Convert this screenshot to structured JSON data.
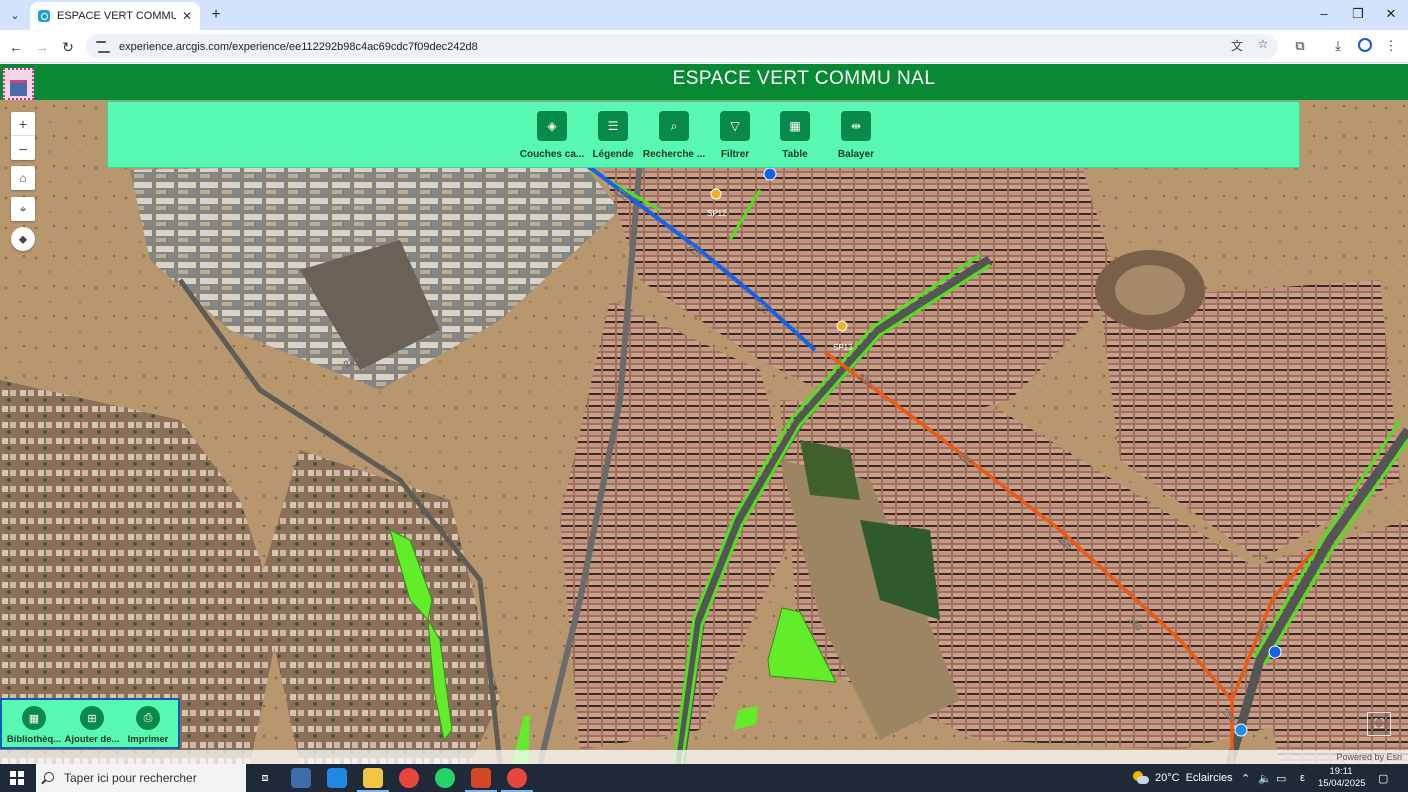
{
  "browser": {
    "tab_title": "ESPACE VERT COMMUNAL",
    "url": "experience.arcgis.com/experience/ee112292b98c4ac69cdc7f09dec242d8",
    "tab_close": "✕",
    "new_tab": "+",
    "minimize": "–",
    "restore": "❐",
    "close": "✕"
  },
  "app": {
    "title": "ESPACE VERT COMMU NAL",
    "header_color": "#088a34",
    "widget_bar_color": "#58f7b2",
    "widgets": [
      {
        "label": "Couches ca...",
        "icon": "layers-icon"
      },
      {
        "label": "Légende",
        "icon": "legend-icon"
      },
      {
        "label": "Recherche ...",
        "icon": "search-icon"
      },
      {
        "label": "Filtrer",
        "icon": "filter-icon"
      },
      {
        "label": "Table",
        "icon": "table-icon"
      },
      {
        "label": "Balayer",
        "icon": "swipe-icon"
      }
    ],
    "bottom_widgets": [
      {
        "label": "Bibliothèq...",
        "icon": "basemap-gallery-icon"
      },
      {
        "label": "Ajouter de...",
        "icon": "add-data-icon"
      },
      {
        "label": "Imprimer",
        "icon": "print-icon"
      }
    ],
    "map_controls": {
      "zoom_in": "+",
      "zoom_out": "–"
    },
    "attribution": "Powered by Esri",
    "road_labels": [
      "225",
      "225",
      "225",
      "225",
      "225",
      "225",
      "225",
      "160",
      "160",
      "160"
    ],
    "station_labels": [
      "SP12",
      "SP13"
    ]
  },
  "taskbar": {
    "search_placeholder": "Taper ici pour rechercher",
    "temperature": "20°C",
    "weather": "Eclaircies",
    "lang": "ε",
    "time": "19:11",
    "date": "15/04/2025"
  }
}
